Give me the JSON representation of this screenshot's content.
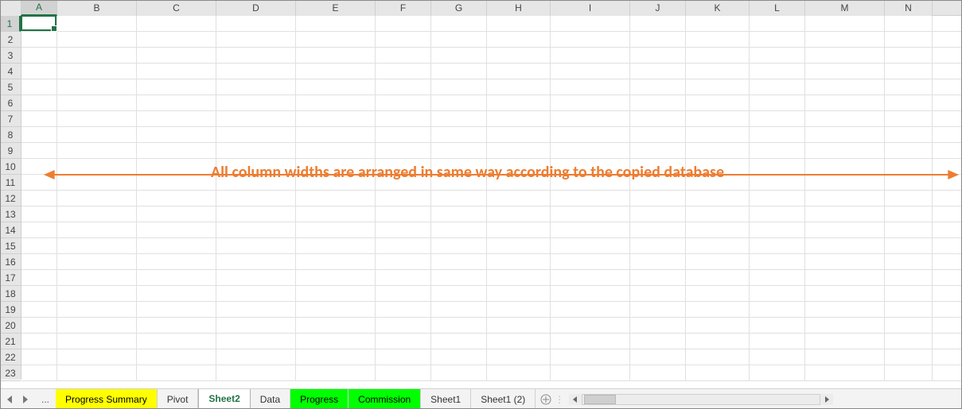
{
  "columns": [
    {
      "label": "A",
      "width": 45,
      "selected": true
    },
    {
      "label": "B",
      "width": 100
    },
    {
      "label": "C",
      "width": 100
    },
    {
      "label": "D",
      "width": 100
    },
    {
      "label": "E",
      "width": 100
    },
    {
      "label": "F",
      "width": 70
    },
    {
      "label": "G",
      "width": 70
    },
    {
      "label": "H",
      "width": 80
    },
    {
      "label": "I",
      "width": 100
    },
    {
      "label": "J",
      "width": 70
    },
    {
      "label": "K",
      "width": 80
    },
    {
      "label": "L",
      "width": 70
    },
    {
      "label": "M",
      "width": 100
    },
    {
      "label": "N",
      "width": 60
    }
  ],
  "rows": [
    {
      "n": "1",
      "selected": true
    },
    {
      "n": "2"
    },
    {
      "n": "3"
    },
    {
      "n": "4"
    },
    {
      "n": "5"
    },
    {
      "n": "6"
    },
    {
      "n": "7"
    },
    {
      "n": "8"
    },
    {
      "n": "9"
    },
    {
      "n": "10"
    },
    {
      "n": "11"
    },
    {
      "n": "12"
    },
    {
      "n": "13"
    },
    {
      "n": "14"
    },
    {
      "n": "15"
    },
    {
      "n": "16"
    },
    {
      "n": "17"
    },
    {
      "n": "18"
    },
    {
      "n": "19"
    },
    {
      "n": "20"
    },
    {
      "n": "21"
    },
    {
      "n": "22"
    },
    {
      "n": "23"
    }
  ],
  "active_cell": {
    "col_index": 0,
    "row_index": 0
  },
  "annotation": {
    "text": "All column widths are arranged in same way according to the copied database",
    "color": "#ED7D31"
  },
  "tabs": {
    "ellipsis": "...",
    "items": [
      {
        "label": "Progress Summary",
        "color": "yellow"
      },
      {
        "label": "Pivot"
      },
      {
        "label": "Sheet2",
        "active": true
      },
      {
        "label": "Data"
      },
      {
        "label": "Progress",
        "color": "green"
      },
      {
        "label": "Commission",
        "color": "green"
      },
      {
        "label": "Sheet1"
      },
      {
        "label": "Sheet1 (2)"
      }
    ]
  }
}
